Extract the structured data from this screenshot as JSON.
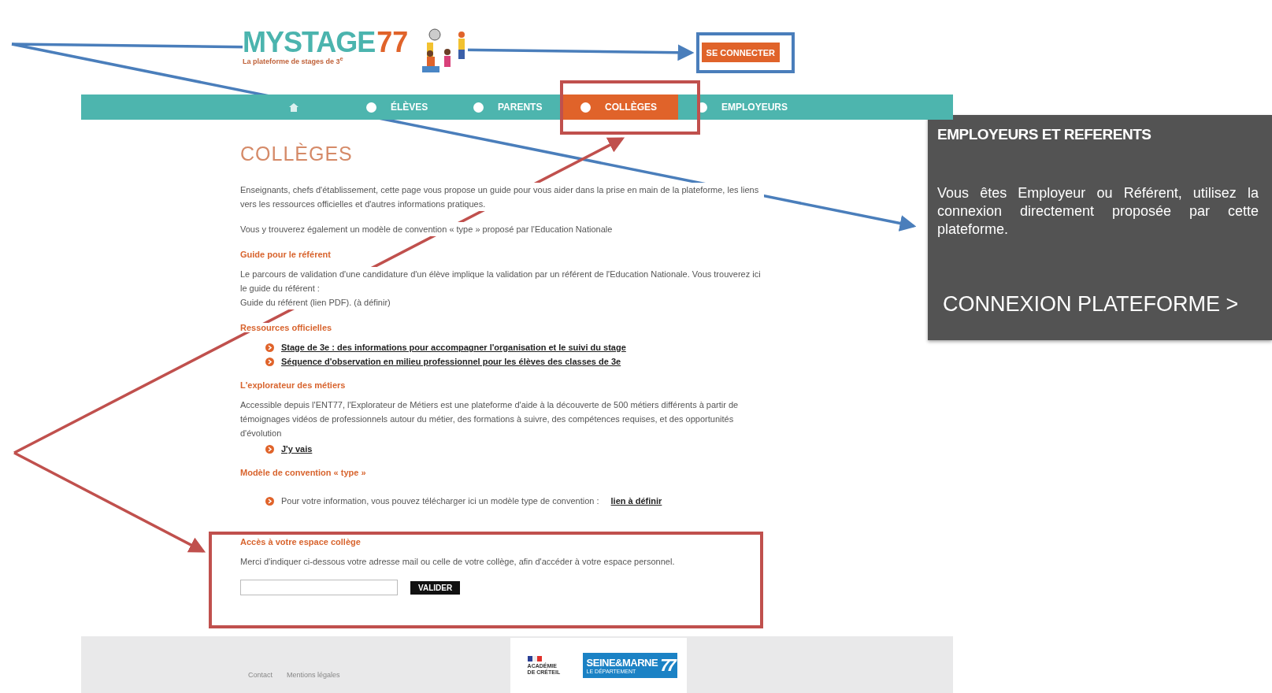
{
  "header": {
    "logo": {
      "wordmark": "MYSTAGE",
      "number": "77",
      "tagline": "La plateforme de stages de 3$^{e}$"
    },
    "login_button": "SE CONNECTER"
  },
  "nav": {
    "tabs": [
      {
        "label": "ÉLÈVES",
        "selected": false
      },
      {
        "label": "PARENTS",
        "selected": false
      },
      {
        "label": "COLLÈGES",
        "selected": true
      },
      {
        "label": "EMPLOYEURS",
        "selected": false
      }
    ]
  },
  "content": {
    "title": "COLLÈGES",
    "blocks": [
      {
        "kind": "paragraph",
        "lines": [
          "Enseignants, chefs d'établissement, cette page vous propose un guide pour vous aider dans la prise en main de la plateforme, les liens vers les ressources officielles et d'autres informations pratiques."
        ]
      },
      {
        "kind": "paragraph",
        "lines": [
          "Vous y trouverez également un modèle de convention « type » proposé par l'Education Nationale"
        ]
      },
      {
        "kind": "heading",
        "text": "Guide pour le référent"
      },
      {
        "kind": "paragraph",
        "lines": [
          "Le parcours de validation d'une candidature d'un élève implique la validation par un référent de l'Education Nationale. Vous trouverez ici le guide du référent :",
          "Guide du référent (lien PDF). (à définir)"
        ]
      },
      {
        "kind": "heading",
        "text": "Ressources officielles"
      },
      {
        "kind": "links",
        "items": [
          "Stage de 3e : des informations pour accompagner l'organisation et le suivi du stage",
          "Séquence d'observation en milieu professionnel pour les élèves des classes de 3e"
        ]
      },
      {
        "kind": "heading",
        "text": "L'explorateur des métiers"
      },
      {
        "kind": "paragraph",
        "lines": [
          "Accessible depuis l'ENT77, l'Explorateur de Métiers est une plateforme d'aide à la découverte de 500 métiers différents à partir de témoignages vidéos de professionnels autour du métier, des formations à suivre, des compétences requises, et des opportunités d'évolution"
        ]
      },
      {
        "kind": "links",
        "items": [
          "J'y vais"
        ]
      },
      {
        "kind": "heading",
        "text": "Modèle de convention « type »"
      },
      {
        "kind": "note",
        "text": "Pour votre information, vous pouvez télécharger ici un modèle type de convention :",
        "link": "lien à définir"
      }
    ],
    "access": {
      "heading": "Accès à votre espace collège",
      "text": "Merci d'indiquer ci-dessous votre adresse mail ou celle de votre collège, afin d'accéder à votre espace personnel.",
      "button": "VALIDER"
    }
  },
  "footer": {
    "links": [
      "Contact",
      "Mentions légales"
    ],
    "academy": "ACADÉMIE DE CRÉTEIL",
    "department": {
      "name": "SEINE&MARNE",
      "subtitle": "LE DÉPARTEMENT",
      "number": "77"
    }
  },
  "callout": {
    "title": "EMPLOYEURS ET REFERENTS",
    "text": "Vous êtes Employeur ou Référent, utilisez la connexion directement proposée par cette plateforme.",
    "link": "CONNEXION PLATEFORME >"
  }
}
